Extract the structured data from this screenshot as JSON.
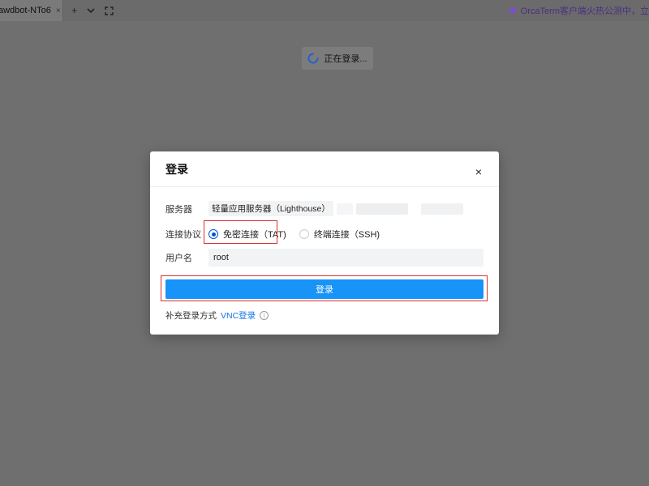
{
  "tabbar": {
    "tab_title": "awdbot-NTo6",
    "tab_close": "×",
    "add_tab": "+",
    "dropdown": "⌄",
    "fullscreen": "⛶",
    "promo_text": "OrcaTerm客户端火热公测中，立"
  },
  "toast": {
    "loading_text": "正在登录..."
  },
  "modal": {
    "title": "登录",
    "close": "×",
    "server": {
      "label": "服务器",
      "value": "轻量应用服务器（Lighthouse）"
    },
    "protocol": {
      "label": "连接协议",
      "options": [
        {
          "label": "免密连接（TAT)",
          "selected": true
        },
        {
          "label": "终端连接（SSH)",
          "selected": false
        }
      ]
    },
    "username": {
      "label": "用户名",
      "value": "root"
    },
    "login_button": "登录",
    "alt_login": {
      "label": "补充登录方式",
      "link": "VNC登录",
      "info": "i"
    }
  },
  "colors": {
    "overlay": "#6f6f6f",
    "primary": "#1893f8",
    "highlight_border": "#d9302f",
    "link": "#1673e6"
  }
}
